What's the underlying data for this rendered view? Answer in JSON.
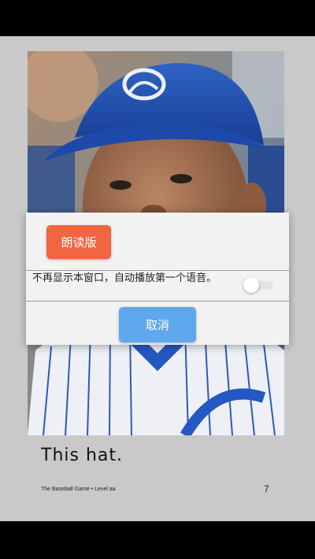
{
  "dialog": {
    "read_aloud_button": "朗读版",
    "notice_text": "不再显示本窗口，自动播放第一个语音。",
    "auto_play_toggle_on": false,
    "cancel_button": "取消"
  },
  "book_page": {
    "text": "This  hat.",
    "footer_caption": "The Baseball Game • Level aa",
    "page_number": "7"
  },
  "colors": {
    "read_button": "#f26540",
    "cancel_button": "#5fa8ee",
    "page_background": "#c9c9c9"
  }
}
